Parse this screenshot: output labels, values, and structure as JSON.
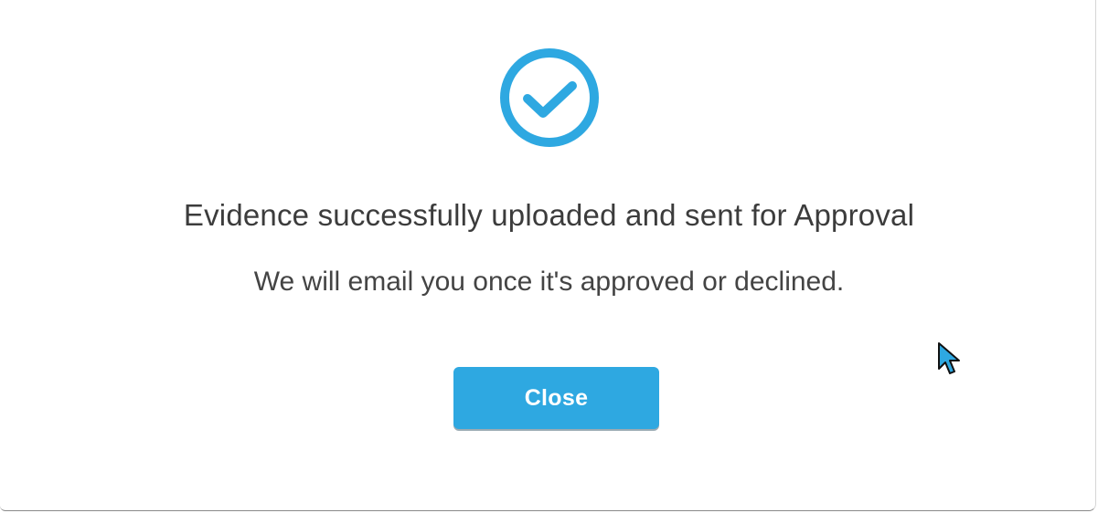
{
  "dialog": {
    "icon": "check-circle-icon",
    "title": "Evidence successfully uploaded and sent for Approval",
    "message": "We will email you once it's approved or declined.",
    "close_label": "Close"
  },
  "colors": {
    "accent": "#2ea8e1",
    "text": "#3c3c3c",
    "background": "#ffffff"
  },
  "cursor": {
    "icon": "mouse-pointer-icon"
  }
}
